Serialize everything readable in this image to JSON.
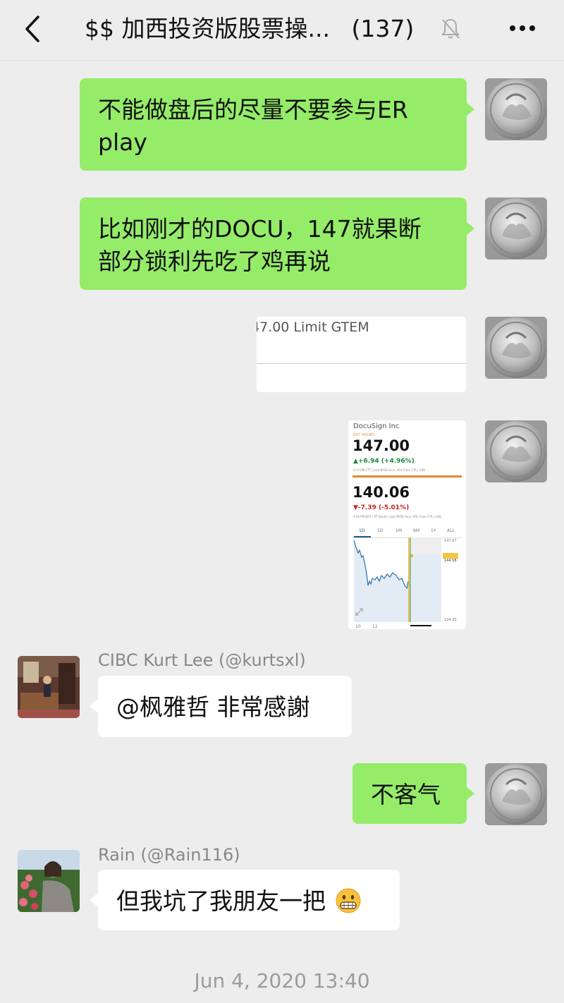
{
  "header": {
    "title": "$$ 加西投资版股票操...",
    "count": "(137)"
  },
  "messages": {
    "m1": "不能做盘后的尽量不要参与ER",
    "m1b": "play",
    "m2": "比如刚才的DOCU，147就果断",
    "m2b": "部分锁利先吃了鸡再说",
    "order_snippet": "47.00 Limit GTEM",
    "kurt_name": "CIBC Kurt Lee (@kurtsxl)",
    "kurt_msg": "@枫雅哲  非常感謝",
    "reply": "不客气",
    "rain_name": "Rain (@Rain116)",
    "rain_msg": "但我坑了我朋友一把"
  },
  "stock": {
    "company": "DocuSign Inc",
    "ext_label": "EXT. HOURS",
    "ext_price": "147.00",
    "ext_change": "▲+6.94 (+4.96%)",
    "ext_note": "4:17 PM CTT | Last NYSE Arca, VOL From CTA | USD",
    "close_price": "140.06",
    "close_change": "▼-7.39 (-5.01%)",
    "close_note": "4:00 PM EDT | RT Quote | Last NYSE Arca, VOL From CTA | USD",
    "tabs": [
      "1D",
      "5D",
      "1M",
      "6M",
      "1Y",
      "ALL"
    ],
    "y_high": "147.87",
    "y_tag": "144.58",
    "y_low": "134.30",
    "x_ticks": [
      "10",
      "12"
    ]
  },
  "timestamp": "Jun 4, 2020 13:40",
  "colors": {
    "bubble_me": "#95ec69",
    "bubble_them": "#ffffff",
    "up": "#1a8a3a",
    "down": "#cc2222",
    "accent": "#e08a2a"
  }
}
